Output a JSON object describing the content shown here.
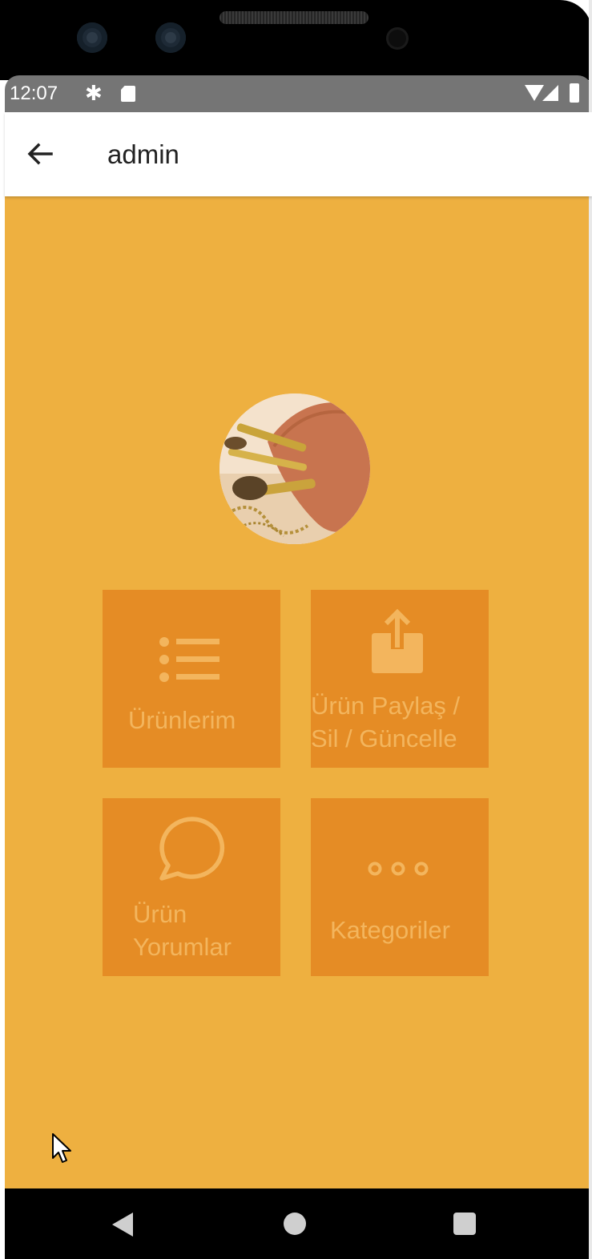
{
  "status_bar": {
    "time": "12:07",
    "icons": [
      "gear-icon",
      "sd-card-icon",
      "wifi-icon",
      "signal-icon",
      "battery-icon"
    ]
  },
  "app_bar": {
    "title": "admin",
    "back_icon": "arrow-back-icon"
  },
  "avatar": {
    "description_icon": "makeup-brushes-photo"
  },
  "menu": {
    "tiles": [
      {
        "label": "Ürünlerim",
        "icon": "list-icon"
      },
      {
        "label": "Ürün Paylaş / Sil / Güncelle",
        "line1": "Ürün Paylaş /",
        "line2": "Sil / Güncelle",
        "icon": "share-icon"
      },
      {
        "label": "Ürün Yorumlar",
        "line1": "Ürün",
        "line2": "Yorumlar",
        "icon": "chat-bubble-icon"
      },
      {
        "label": "Kategoriler",
        "icon": "more-horizontal-icon"
      }
    ]
  },
  "nav_bar": {
    "buttons": [
      "back-nav-icon",
      "home-nav-icon",
      "recents-nav-icon"
    ]
  },
  "colors": {
    "background": "#eeb040",
    "tile": "#e58c25",
    "tile_content": "#f3b55d",
    "status_bar": "#757575",
    "app_bar": "#ffffff"
  }
}
